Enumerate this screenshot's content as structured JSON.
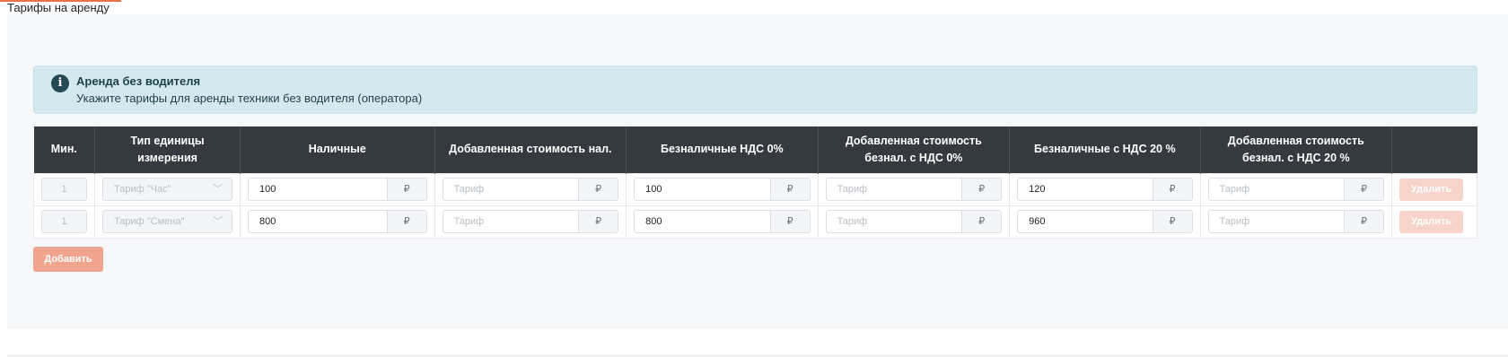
{
  "page_title": "Тарифы на аренду",
  "alert": {
    "icon": "info-icon",
    "icon_glyph": "i",
    "title": "Аренда без водителя",
    "text": "Укажите тарифы для аренды техники без водителя (оператора)"
  },
  "table": {
    "headers": [
      "Мин.",
      "Тип единицы измерения",
      "Наличные",
      "Добавленная стоимость нал.",
      "Безналичные НДС 0%",
      "Добавленная стоимость безнал. с НДС 0%",
      "Безналичные с НДС 20 %",
      "Добавленная стоимость безнал. с НДС 20 %",
      ""
    ],
    "currency": "₽",
    "placeholder": "Тариф",
    "delete_label": "Удалить",
    "rows": [
      {
        "min": "1",
        "unit": "Тариф \"Час\"",
        "cash": "100",
        "vat0": "100",
        "vat20": "120"
      },
      {
        "min": "1",
        "unit": "Тариф \"Смена\"",
        "cash": "800",
        "vat0": "800",
        "vat20": "960"
      }
    ]
  },
  "add_label": "Добавить",
  "colors": {
    "accent": "#e9724d",
    "header_bg": "#343a40",
    "alert_bg": "#d4e9ee",
    "add_button": "#f2a58e",
    "delete_button": "#f7d4c9"
  }
}
